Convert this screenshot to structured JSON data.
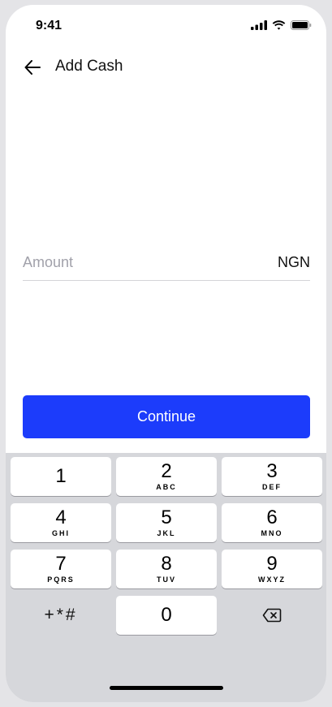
{
  "status": {
    "time": "9:41"
  },
  "header": {
    "title": "Add Cash",
    "back_icon": "arrow-left-icon"
  },
  "form": {
    "amount_placeholder": "Amount",
    "amount_value": "",
    "currency": "NGN"
  },
  "actions": {
    "continue_label": "Continue",
    "continue_color": "#1c3cfb"
  },
  "keypad": {
    "keys": [
      {
        "num": "1",
        "letters": ""
      },
      {
        "num": "2",
        "letters": "ABC"
      },
      {
        "num": "3",
        "letters": "DEF"
      },
      {
        "num": "4",
        "letters": "GHI"
      },
      {
        "num": "5",
        "letters": "JKL"
      },
      {
        "num": "6",
        "letters": "MNO"
      },
      {
        "num": "7",
        "letters": "PQRS"
      },
      {
        "num": "8",
        "letters": "TUV"
      },
      {
        "num": "9",
        "letters": "WXYZ"
      },
      {
        "num": "0",
        "letters": ""
      }
    ],
    "symbols": "+*#",
    "delete_icon": "backspace-icon"
  }
}
